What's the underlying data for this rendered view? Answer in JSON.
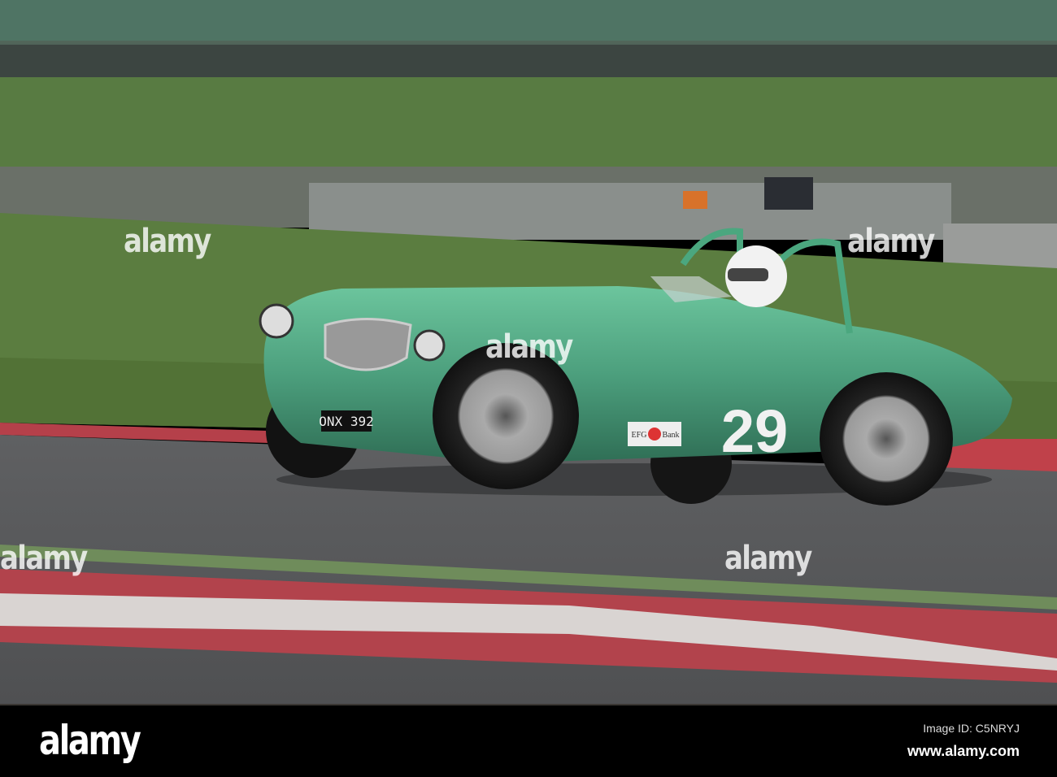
{
  "photo": {
    "car_number": "29",
    "license_plate": "ONX 392",
    "sponsor_left": "EFG",
    "sponsor_right": "Bank",
    "colors": {
      "car": "#4c9f7d",
      "grass": "#5b7a3e",
      "track": "#5d5e60",
      "kerb_red": "#b5404a"
    }
  },
  "watermarks": [
    "alamy",
    "alamy",
    "alamy",
    "alamy",
    "alamy"
  ],
  "footer": {
    "logo": "alamy",
    "image_id": "Image ID: C5NRYJ",
    "website": "www.alamy.com"
  }
}
